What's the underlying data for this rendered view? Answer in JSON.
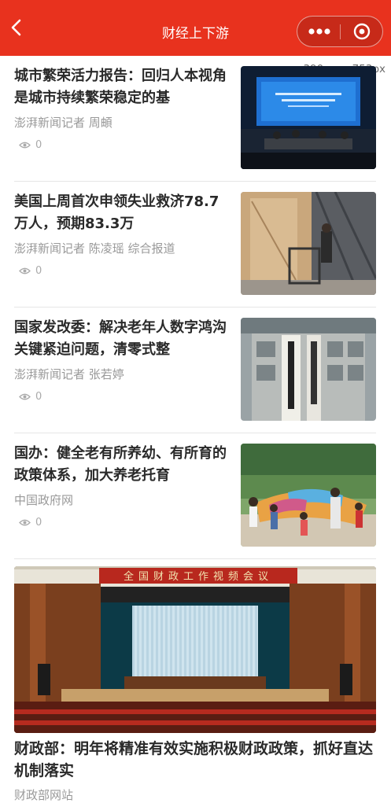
{
  "nav": {
    "title": "财经上下游"
  },
  "overlay": {
    "dimensions": "390px × 753px"
  },
  "colors": {
    "nav_bg": "#e8321e",
    "title_text": "#2a2a2a",
    "meta_text": "#999999"
  },
  "articles": [
    {
      "title": "城市繁荣活力报告：回归人本视角是城市持续繁荣稳定的基",
      "source": "澎湃新闻记者 周頔",
      "views": "0"
    },
    {
      "title": "美国上周首次申领失业救济78.7万人，预期83.3万",
      "source": "澎湃新闻记者 陈凌瑶 综合报道",
      "views": "0"
    },
    {
      "title": "国家发改委：解决老年人数字鸿沟关键紧迫问题，清零式整",
      "source": "澎湃新闻记者 张若婷",
      "views": "0"
    },
    {
      "title": "国办：健全老有所养幼、有所育的政策体系，加大养老托育",
      "source": "中国政府网",
      "views": "0"
    }
  ],
  "featured": {
    "banner": "全国财政工作视频会议",
    "title": "财政部：明年将精准有效实施积极财政政策，抓好直达机制落实",
    "source": "财政部网站"
  }
}
